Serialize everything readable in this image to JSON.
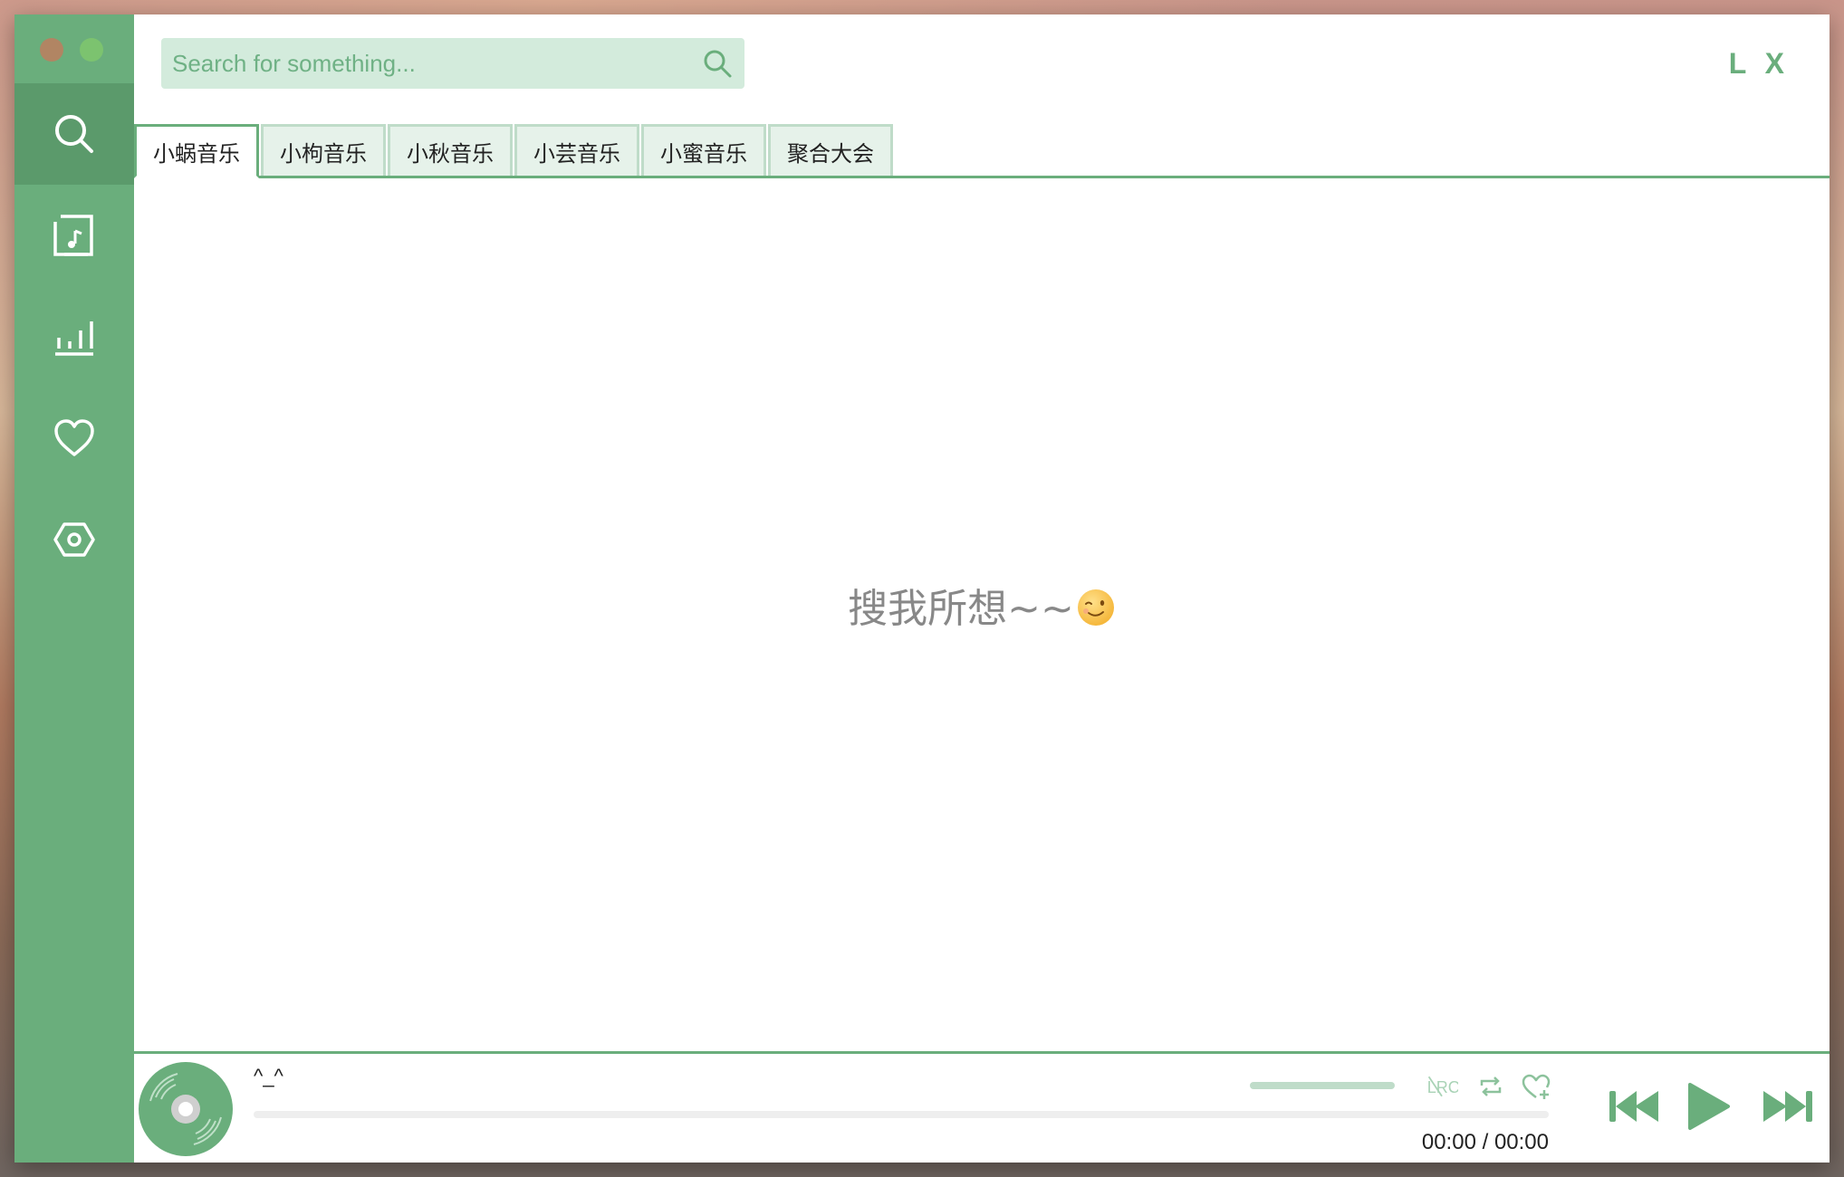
{
  "window": {
    "traffic_lights": [
      "close",
      "maximize"
    ]
  },
  "sidebar": {
    "items": [
      {
        "name": "search",
        "icon": "search-icon",
        "active": true
      },
      {
        "name": "song-list",
        "icon": "music-list-icon",
        "active": false
      },
      {
        "name": "leaderboard",
        "icon": "bar-chart-icon",
        "active": false
      },
      {
        "name": "my-list",
        "icon": "heart-icon",
        "active": false
      },
      {
        "name": "settings",
        "icon": "hexagon-settings-icon",
        "active": false
      }
    ]
  },
  "header": {
    "search": {
      "value": "",
      "placeholder": "Search for something..."
    },
    "logo": "L X"
  },
  "tabs": [
    {
      "label": "小蜗音乐",
      "active": true
    },
    {
      "label": "小枸音乐",
      "active": false
    },
    {
      "label": "小秋音乐",
      "active": false
    },
    {
      "label": "小芸音乐",
      "active": false
    },
    {
      "label": "小蜜音乐",
      "active": false
    },
    {
      "label": "聚合大会",
      "active": false
    }
  ],
  "main": {
    "message": "搜我所想~~",
    "emoji_icon": "wink-emoji-icon"
  },
  "player": {
    "song_name": "^_^",
    "current_time": "00:00",
    "separator": "/",
    "total_time": "00:00",
    "progress": 0,
    "lrc_label": "LRC"
  },
  "colors": {
    "accent": "#6aae7c",
    "accent_dark": "#5b9a6b",
    "accent_light": "#d3ebdc",
    "text_muted": "#888888"
  }
}
